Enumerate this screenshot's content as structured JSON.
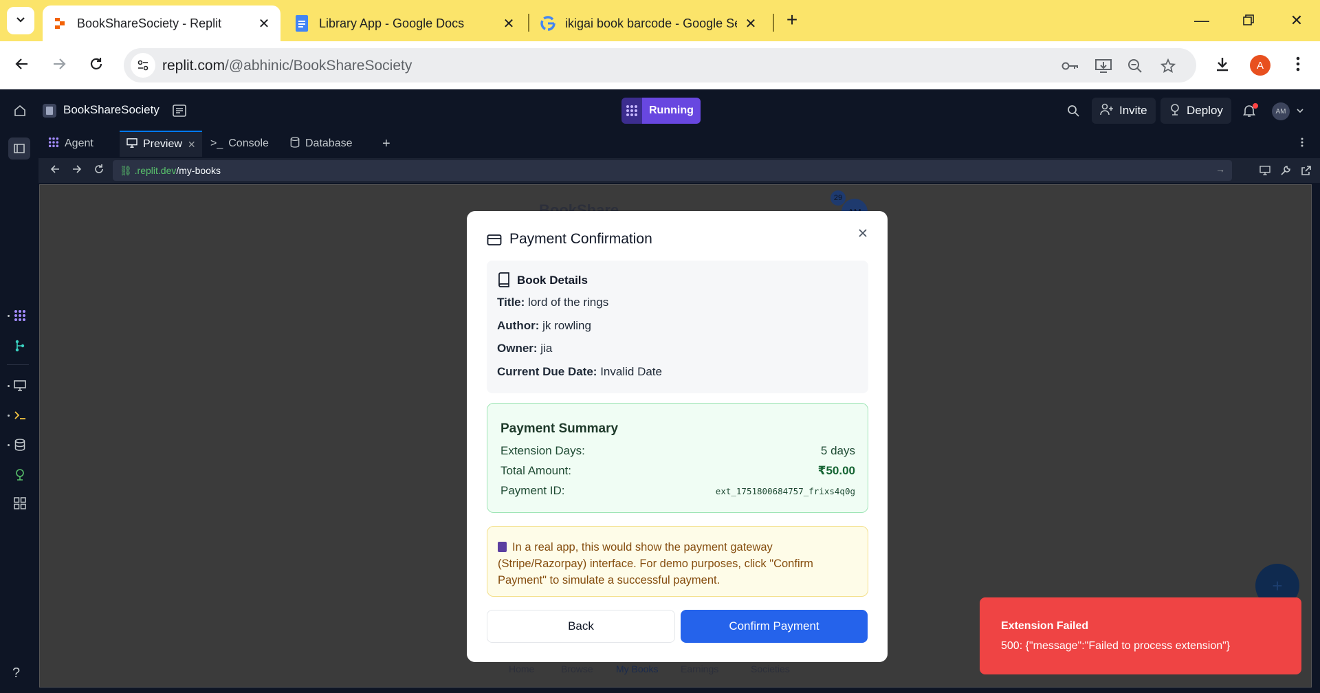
{
  "browser": {
    "tabs": [
      {
        "title": "BookShareSociety - Replit",
        "icon": "replit-icon"
      },
      {
        "title": "Library App - Google Docs",
        "icon": "google-docs-icon"
      },
      {
        "title": "ikigai book barcode - Google Se",
        "icon": "google-icon"
      }
    ],
    "url_domain": "replit.com",
    "url_path": "/@abhinic/BookShareSociety",
    "profile_initial": "A"
  },
  "replit": {
    "repl_name": "BookShareSociety",
    "status": "Running",
    "invite_label": "Invite",
    "deploy_label": "Deploy",
    "avatar_initials": "AM",
    "pane_tabs": [
      {
        "label": "Agent"
      },
      {
        "label": "Preview"
      },
      {
        "label": "Console"
      },
      {
        "label": "Database"
      }
    ],
    "preview_url_domain": ".replit.dev",
    "preview_url_path": "/my-books"
  },
  "background_app": {
    "brand": "BookShare",
    "badge_count": "29",
    "avatar": "AM",
    "nav": [
      "Home",
      "Browse",
      "My Books",
      "Earnings",
      "Societies"
    ]
  },
  "modal": {
    "title": "Payment Confirmation",
    "book_section_title": "Book Details",
    "book": {
      "title_label": "Title:",
      "title_value": "lord of the rings",
      "author_label": "Author:",
      "author_value": "jk rowling",
      "owner_label": "Owner:",
      "owner_value": "jia",
      "due_label": "Current Due Date:",
      "due_value": "Invalid Date"
    },
    "summary": {
      "title": "Payment Summary",
      "days_label": "Extension Days:",
      "days_value": "5 days",
      "amount_label": "Total Amount:",
      "amount_value": "₹50.00",
      "id_label": "Payment ID:",
      "id_value": "ext_1751800684757_frixs4q0g"
    },
    "note": "In a real app, this would show the payment gateway (Stripe/Razorpay) interface. For demo purposes, click \"Confirm Payment\" to simulate a successful payment.",
    "back_label": "Back",
    "confirm_label": "Confirm Payment"
  },
  "toast": {
    "title": "Extension Failed",
    "message": "500: {\"message\":\"Failed to process extension\"}"
  },
  "colors": {
    "chrome_tabstrip": "#fbe46a",
    "replit_bg": "#0e1525",
    "running_accent": "#6847e0",
    "confirm_button": "#2563eb",
    "toast_error": "#ef4444"
  }
}
